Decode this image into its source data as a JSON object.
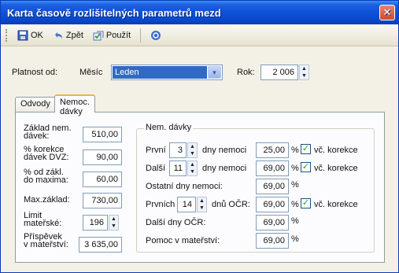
{
  "window": {
    "title": "Karta časově rozlišitelných parametrů mezd",
    "close_glyph": "✕"
  },
  "toolbar": {
    "ok": "OK",
    "back": "Zpět",
    "apply": "Použít"
  },
  "header": {
    "platnost_label": "Platnost od:",
    "mesic_label": "Měsíc",
    "mesic_value": "Leden",
    "rok_label": "Rok:",
    "rok_value": "2 006"
  },
  "tabs": [
    "Odvody",
    "Nemoc. dávky"
  ],
  "left": {
    "zaklad_label_1": "Základ nem.",
    "zaklad_label_2": "dávek:",
    "zaklad_value": "510,00",
    "korekce_label_1": "% korekce",
    "korekce_label_2": "dávek DVZ:",
    "korekce_value": "90,00",
    "maxima_label_1": "% od zákl.",
    "maxima_label_2": "do maxima:",
    "maxima_value": "60,00",
    "maxzaklad_label": "Max.základ:",
    "maxzaklad_value": "730,00",
    "limit_label_1": "Limit",
    "limit_label_2": "mateřské:",
    "limit_value": "196",
    "prispevek_label_1": "Příspěvek",
    "prispevek_label_2": "v mateřství:",
    "prispevek_value": "3 635,00"
  },
  "group": {
    "title": "Nem. dávky",
    "rows": [
      {
        "label": "První",
        "days": "3",
        "unit": "dny nemoci",
        "value": "25,00",
        "pct": "%",
        "check_label": "vč. korekce"
      },
      {
        "label": "Další",
        "days": "11",
        "unit": "dny nemoci",
        "value": "69,00",
        "pct": "%",
        "check_label": "vč. korekce"
      },
      {
        "label": "Ostatní dny nemoci:",
        "value": "69,00",
        "pct": "%"
      },
      {
        "label": "Prvních",
        "days": "14",
        "unit": "dnů OČR:",
        "value": "69,00",
        "pct": "%",
        "check_label": "vč. korekce"
      },
      {
        "label": "Další dny OČR:",
        "value": "69,00",
        "pct": "%"
      },
      {
        "label": "Pomoc v mateřství:",
        "value": "69,00",
        "pct": "%"
      }
    ]
  },
  "icons": {
    "save": "save-icon",
    "back": "undo-icon",
    "apply": "apply-icon",
    "help": "help-icon",
    "dropdown": "chevron-down-icon"
  },
  "colors": {
    "title_bar": "#0a46c8",
    "selection": "#316ac5",
    "active_tab_accent": "#f4b33c",
    "check": "#21a121",
    "close": "#d14b2c"
  }
}
